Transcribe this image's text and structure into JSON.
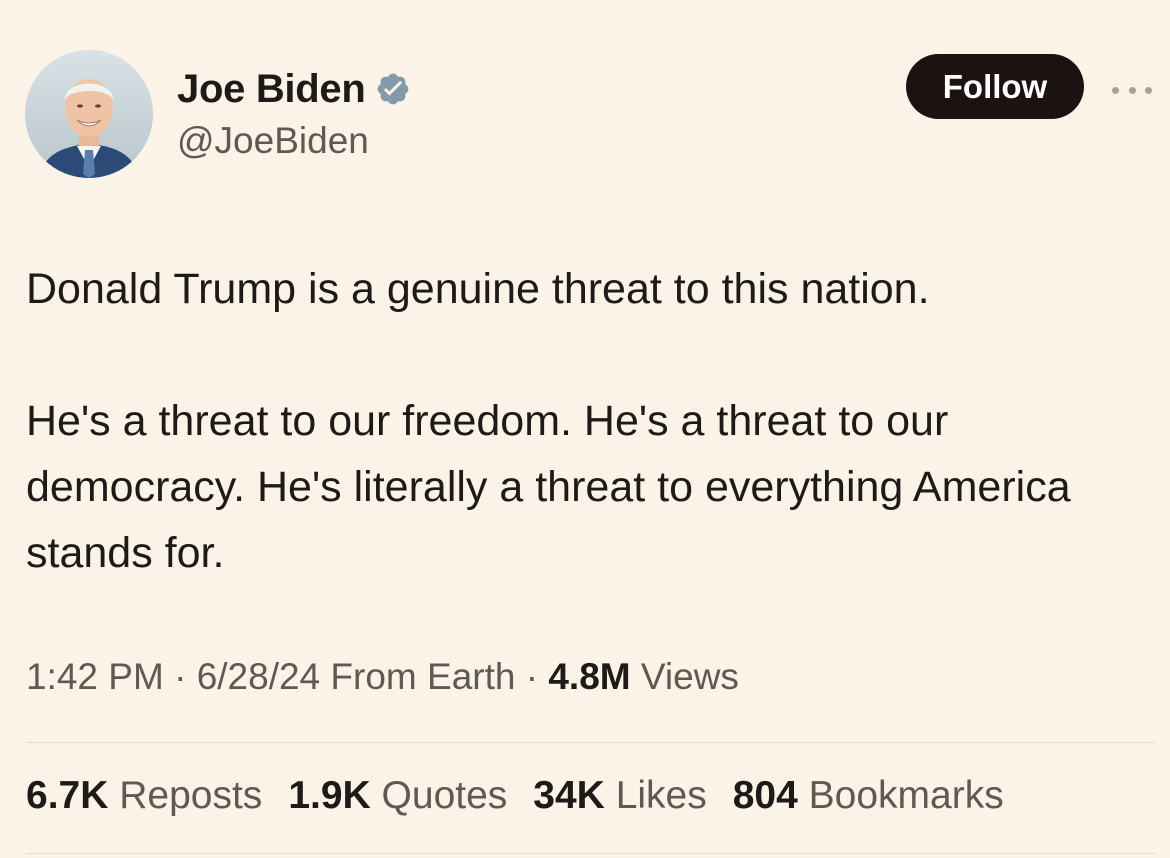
{
  "author": {
    "display_name": "Joe Biden",
    "handle": "@JoeBiden",
    "verified": true,
    "verified_color": "#829aab"
  },
  "actions": {
    "follow_label": "Follow",
    "more_icon": "ellipsis-icon"
  },
  "tweet": {
    "paragraphs": [
      "Donald Trump is a genuine threat to this nation.",
      "He's a threat to our freedom. He's a threat to our democracy. He's literally a threat to everything America stands for."
    ]
  },
  "meta": {
    "time": "1:42 PM",
    "date": "6/28/24",
    "source": "From Earth",
    "views_count": "4.8M",
    "views_label": "Views"
  },
  "stats": [
    {
      "count": "6.7K",
      "label": "Reposts"
    },
    {
      "count": "1.9K",
      "label": "Quotes"
    },
    {
      "count": "34K",
      "label": "Likes"
    },
    {
      "count": "804",
      "label": "Bookmarks"
    }
  ],
  "colors": {
    "background": "#fbf3e8",
    "follow_button": "#1c1212",
    "secondary_text": "#5f5952"
  }
}
